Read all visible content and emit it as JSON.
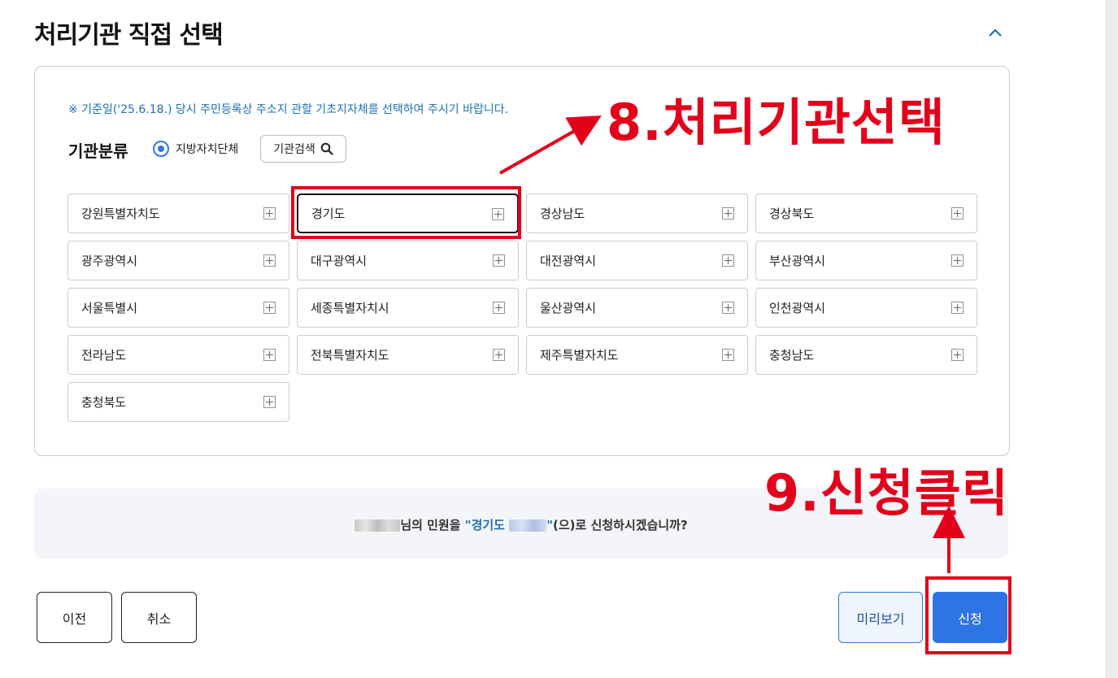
{
  "section": {
    "title": "처리기관 직접 선택"
  },
  "notice": "※ 기준일('25.6.18.) 당시 주민등록상 주소지 관할 기초지자체를 선택하여 주시기 바랍니다.",
  "classification": {
    "label": "기관분류",
    "radio_label": "지방자치단체",
    "radio_selected": true,
    "search_button": "기관검색"
  },
  "regions": [
    {
      "name": "강원특별자치도",
      "selected": false
    },
    {
      "name": "경기도",
      "selected": true
    },
    {
      "name": "경상남도",
      "selected": false
    },
    {
      "name": "경상북도",
      "selected": false
    },
    {
      "name": "광주광역시",
      "selected": false
    },
    {
      "name": "대구광역시",
      "selected": false
    },
    {
      "name": "대전광역시",
      "selected": false
    },
    {
      "name": "부산광역시",
      "selected": false
    },
    {
      "name": "서울특별시",
      "selected": false
    },
    {
      "name": "세종특별자치시",
      "selected": false
    },
    {
      "name": "울산광역시",
      "selected": false
    },
    {
      "name": "인천광역시",
      "selected": false
    },
    {
      "name": "전라남도",
      "selected": false
    },
    {
      "name": "전북특별자치도",
      "selected": false
    },
    {
      "name": "제주특별자치도",
      "selected": false
    },
    {
      "name": "충청남도",
      "selected": false
    },
    {
      "name": "충청북도",
      "selected": false
    }
  ],
  "confirm": {
    "part1": "님의 민원을 ",
    "quote_open": "\"경기도 ",
    "quote_close": "\"",
    "part2": "(으)로 신청하시겠습니까?"
  },
  "buttons": {
    "prev": "이전",
    "cancel": "취소",
    "preview": "미리보기",
    "submit": "신청"
  },
  "annotations": {
    "step8": "8.처리기관선택",
    "step9": "9.신청클릭"
  },
  "colors": {
    "accent": "#2f74e6",
    "annotation": "#e3001b",
    "notice": "#1f6fb5"
  }
}
